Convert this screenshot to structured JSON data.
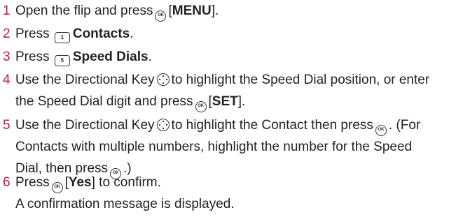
{
  "steps": [
    {
      "number": "1",
      "lines": [
        {
          "text_1": "Open the flip and press",
          "text_2": "[",
          "bold": "MENU",
          "text_3": "]."
        }
      ]
    },
    {
      "number": "2",
      "text_1": "Press",
      "key_label": "1",
      "bold": "Contacts",
      "text_2": "."
    },
    {
      "number": "3",
      "text_1": "Press",
      "key_label": "5",
      "bold": "Speed Dials",
      "text_2": "."
    },
    {
      "number": "4",
      "line_1_a": "Use the Directional Key",
      "line_1_b": "to highlight the Speed Dial position, or enter",
      "line_2_a": "the Speed Dial digit and press",
      "line_2_b": "[",
      "line_2_bold": "SET",
      "line_2_c": "]."
    },
    {
      "number": "5",
      "line_1_a": "Use the Directional Key",
      "line_1_b": "to highlight the Contact then press",
      "line_1_c": ". (For",
      "line_2": "Contacts with multiple numbers, highlight the number for the Speed",
      "line_3_a": "Dial, then press",
      "line_3_b": ".)"
    },
    {
      "number": "6",
      "line_1_a": "Press",
      "line_1_b": "[",
      "line_1_bold": "Yes",
      "line_1_c": "] to confirm.",
      "line_2": "A confirmation message is displayed."
    }
  ],
  "icons": {
    "ok_key": "ok-key-icon",
    "num_key": "number-key-icon",
    "directional_key": "directional-key-icon"
  },
  "colors": {
    "step_number": "#c51454",
    "text": "#222222"
  }
}
